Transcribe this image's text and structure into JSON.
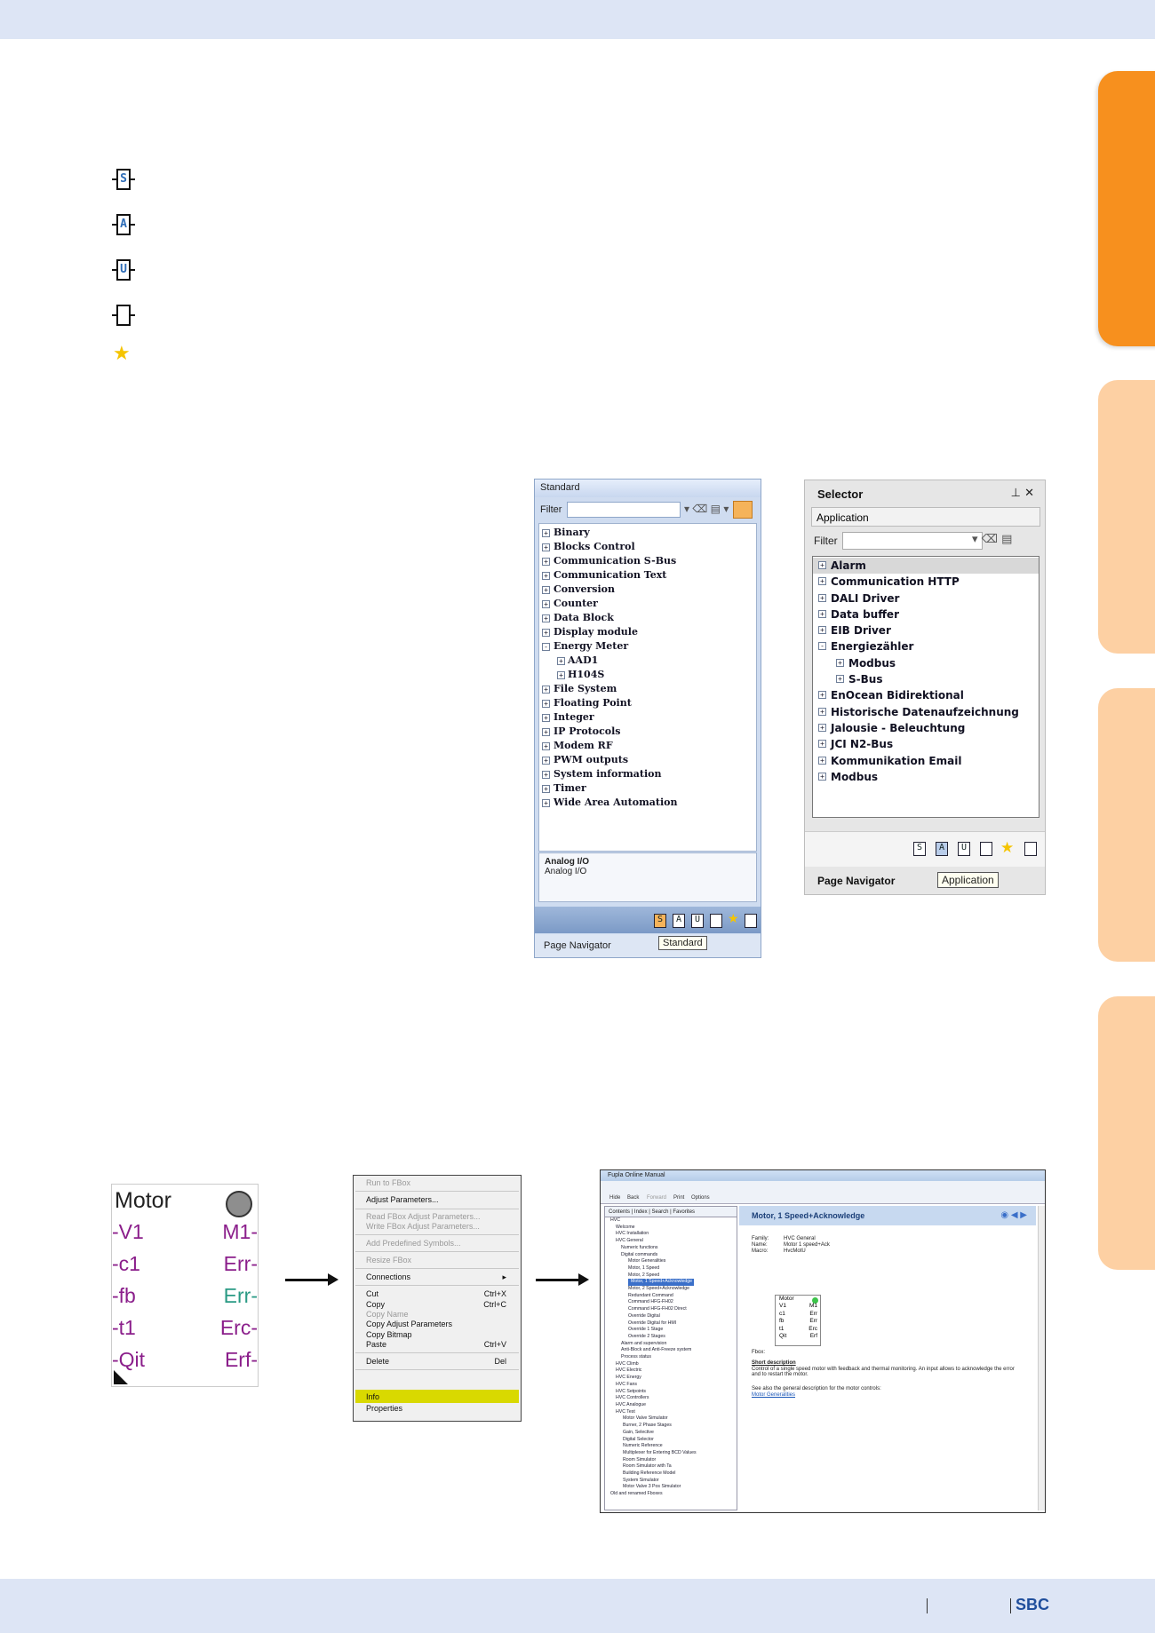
{
  "brand": "SBC",
  "standard_panel": {
    "title": "Standard",
    "filter_label": "Filter",
    "items": [
      {
        "label": "Analog I/O",
        "expander": "+",
        "selected": true
      },
      {
        "label": "Binary",
        "expander": "+"
      },
      {
        "label": "Blocks Control",
        "expander": "+"
      },
      {
        "label": "Communication S-Bus",
        "expander": "+"
      },
      {
        "label": "Communication Text",
        "expander": "+"
      },
      {
        "label": "Conversion",
        "expander": "+"
      },
      {
        "label": "Counter",
        "expander": "+"
      },
      {
        "label": "Data Block",
        "expander": "+"
      },
      {
        "label": "Display module",
        "expander": "+"
      },
      {
        "label": "Energy Meter",
        "expander": "-"
      },
      {
        "label": "AAD1",
        "expander": "+",
        "child": true
      },
      {
        "label": "H104S",
        "expander": "+",
        "child": true
      },
      {
        "label": "File System",
        "expander": "+"
      },
      {
        "label": "Floating Point",
        "expander": "+"
      },
      {
        "label": "Integer",
        "expander": "+"
      },
      {
        "label": "IP Protocols",
        "expander": "+"
      },
      {
        "label": "Modem RF",
        "expander": "+"
      },
      {
        "label": "PWM outputs",
        "expander": "+"
      },
      {
        "label": "System information",
        "expander": "+"
      },
      {
        "label": "Timer",
        "expander": "+"
      },
      {
        "label": "Wide Area Automation",
        "expander": "+"
      }
    ],
    "description_title": "Analog I/O",
    "description_text": "Analog I/O",
    "page_navigator": "Page Navigator",
    "tooltip": "Standard"
  },
  "selector_panel": {
    "title": "Selector",
    "pin_icon": "pin-icon",
    "close_icon": "close-icon",
    "library": "Application",
    "filter_label": "Filter",
    "items": [
      {
        "label": "Alarm",
        "expander": "+",
        "selected": true
      },
      {
        "label": "Communication HTTP",
        "expander": "+"
      },
      {
        "label": "DALI Driver",
        "expander": "+"
      },
      {
        "label": "Data buffer",
        "expander": "+"
      },
      {
        "label": "EIB Driver",
        "expander": "+"
      },
      {
        "label": "Energiezähler",
        "expander": "-"
      },
      {
        "label": "Modbus",
        "expander": "+",
        "child": true
      },
      {
        "label": "S-Bus",
        "expander": "+",
        "child": true
      },
      {
        "label": "EnOcean Bidirektional",
        "expander": "+"
      },
      {
        "label": "Historische Datenaufzeichnung",
        "expander": "+"
      },
      {
        "label": "Jalousie - Beleuchtung",
        "expander": "+"
      },
      {
        "label": "JCI N2-Bus",
        "expander": "+"
      },
      {
        "label": "Kommunikation Email",
        "expander": "+"
      },
      {
        "label": "Modbus",
        "expander": "+"
      }
    ],
    "page_navigator": "Page Navigator",
    "tooltip": "Application"
  },
  "legend_letters": [
    "S",
    "A",
    "U",
    ""
  ],
  "motor_block": {
    "title": "Motor",
    "inputs": [
      "-V1",
      "-c1",
      "-fb",
      "-t1",
      "-Qit"
    ],
    "outputs": [
      "M1-",
      "Err-",
      "Err-",
      "Erc-",
      "Erf-"
    ]
  },
  "context_menu": {
    "items": [
      {
        "label": "Run to FBox",
        "disabled": true
      },
      {
        "label": "Adjust Parameters..."
      },
      {
        "label": "Read FBox Adjust Parameters...",
        "disabled": true
      },
      {
        "label": "Write FBox Adjust Parameters...",
        "disabled": true
      },
      {
        "label": "Add Predefined Symbols...",
        "disabled": true
      },
      {
        "label": "Resize FBox",
        "disabled": true
      },
      {
        "label": "Connections",
        "submenu": "▸"
      },
      {
        "label": "Cut",
        "shortcut": "Ctrl+X"
      },
      {
        "label": "Copy",
        "shortcut": "Ctrl+C"
      },
      {
        "label": "Copy Name",
        "disabled": true
      },
      {
        "label": "Copy Adjust Parameters"
      },
      {
        "label": "Copy Bitmap"
      },
      {
        "label": "Paste",
        "shortcut": "Ctrl+V"
      },
      {
        "label": "Delete",
        "shortcut": "Del"
      },
      {
        "label": "Info",
        "highlighted": true
      },
      {
        "label": "Properties"
      }
    ]
  },
  "help_window": {
    "title": "Fupla Online Manual",
    "toolbar": [
      "Hide",
      "Back",
      "Forward",
      "Print",
      "Options"
    ],
    "tabs": "Contents | Index | Search | Favorites",
    "tree": [
      "HVC",
      "Welcome",
      "HVC Installation",
      "HVC General",
      "Numeric functions",
      "Digital commands",
      "Motor Generalities",
      "Motor, 1 Speed",
      "Motor, 2 Speed",
      "Motor, 1 Speed+Acknowledge",
      "Motor, 2 Speed+Acknowledge",
      "Redundant Command",
      "Command HFG-FH02",
      "Command HFG-FH02 Direct",
      "Override Digital",
      "Override Digital for HMI",
      "Override 1 Stage",
      "Override 2 Stages",
      "Alarm and supervision",
      "Anti-Block and Anti-Freeze system",
      "Process status",
      "HVC Climb",
      "HVC Electric",
      "HVC Energy",
      "HVC Fans",
      "HVC Setpoints",
      "HVC Controllers",
      "HVC Analogue",
      "HVC Test",
      "Motor Valve Simulator",
      "Burner, 2 Phase Stages",
      "Gain, Selective",
      "Digital Selector",
      "Numeric Reference",
      "Multiplexer for Entering BCD Values",
      "Room Simulator",
      "Room Simulator with Ta",
      "Building Reference Model",
      "System Simulator",
      "Motor Valve 3 Pos Simulator",
      "Old and renamed Fboxes"
    ],
    "heading": "Motor, 1 Speed+Acknowledge",
    "family_label": "Family:",
    "family": "HVC General",
    "name_label": "Name:",
    "name": "Motor 1 speed+Ack",
    "macro_label": "Macro:",
    "macro": "HvcMotU",
    "fbox_label": "Fbox:",
    "mini_title": "Motor",
    "mini_inputs": [
      "V1",
      "c1",
      "fb",
      "t1",
      "Qit"
    ],
    "mini_outputs": [
      "M1",
      "Err",
      "Err",
      "Erc",
      "Erf"
    ],
    "short_desc_title": "Short description",
    "short_desc": "Control of a single speed motor with feedback and thermal monitoring. An input allows to acknowledge the error and to restart the motor.",
    "see_also": "See also the general description for the motor controls:",
    "link": "Motor Generalities"
  }
}
